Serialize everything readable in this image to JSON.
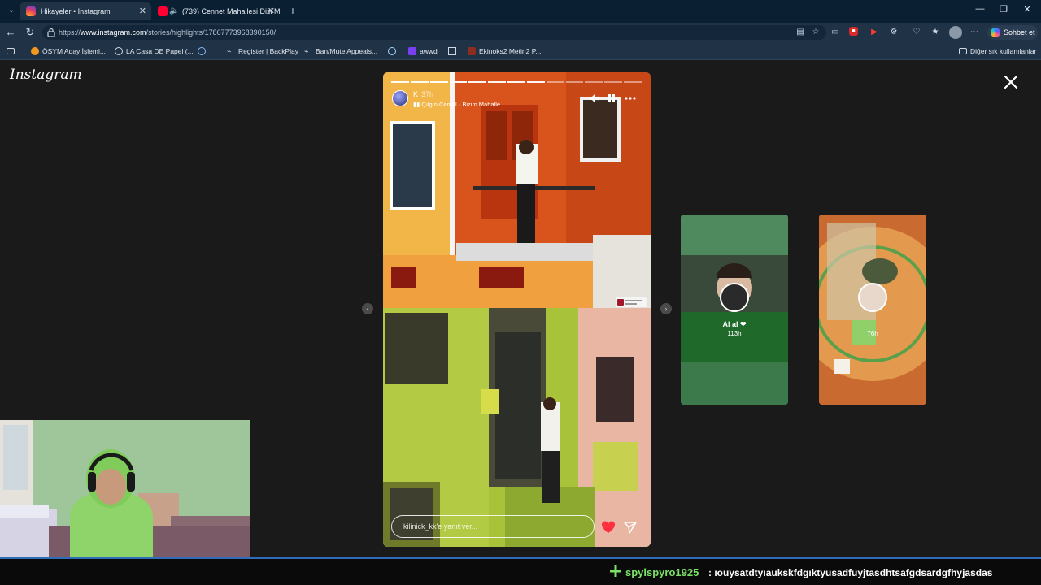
{
  "browser": {
    "tabs": [
      {
        "label": "Hikayeler • Instagram",
        "active": true,
        "icon": "instagram-icon"
      },
      {
        "label": "(739) Cennet Mahallesi Dizi M",
        "active": false,
        "icon": "youtube-icon",
        "muted": true
      }
    ],
    "url_prefix": "https://",
    "url_domain": "www.instagram.com",
    "url_path": "/stories/highlights/17867773968390150/",
    "copilot_label": "Sohbet et",
    "bookmarks": [
      "ÖSYM Aday İşlemi...",
      "LA Casa DE Papel (...",
      "Register | BackPlay",
      "Ban/Mute Appeals...",
      "awwd",
      "Ekinoks2 Metin2 P..."
    ],
    "other_bookmarks": "Diğer sık kullanılanlar"
  },
  "instagram": {
    "logo": "Instagram",
    "story": {
      "username": "K",
      "age": "37h",
      "music": "Çılgın Cemal · Bizim Mahalle",
      "reply_placeholder": "kilinick_kk'e yanıt ver...",
      "progress_segments": 13,
      "progress_done": 8
    },
    "next_highlights": [
      {
        "name": "Al al ❤",
        "time": "113h"
      },
      {
        "name": "",
        "time": "76h"
      }
    ]
  },
  "chat": {
    "username": "spylspyro1925",
    "separator": ":",
    "message": "ıouysatdtyıaukskfdgıktyusadfuyjtasdhtsafgdsardgfhyjasdas"
  },
  "colors": {
    "chat_username": "#7be066",
    "instagram_bg": "#1a1a1a",
    "browser_frame": "#0b1f33"
  }
}
